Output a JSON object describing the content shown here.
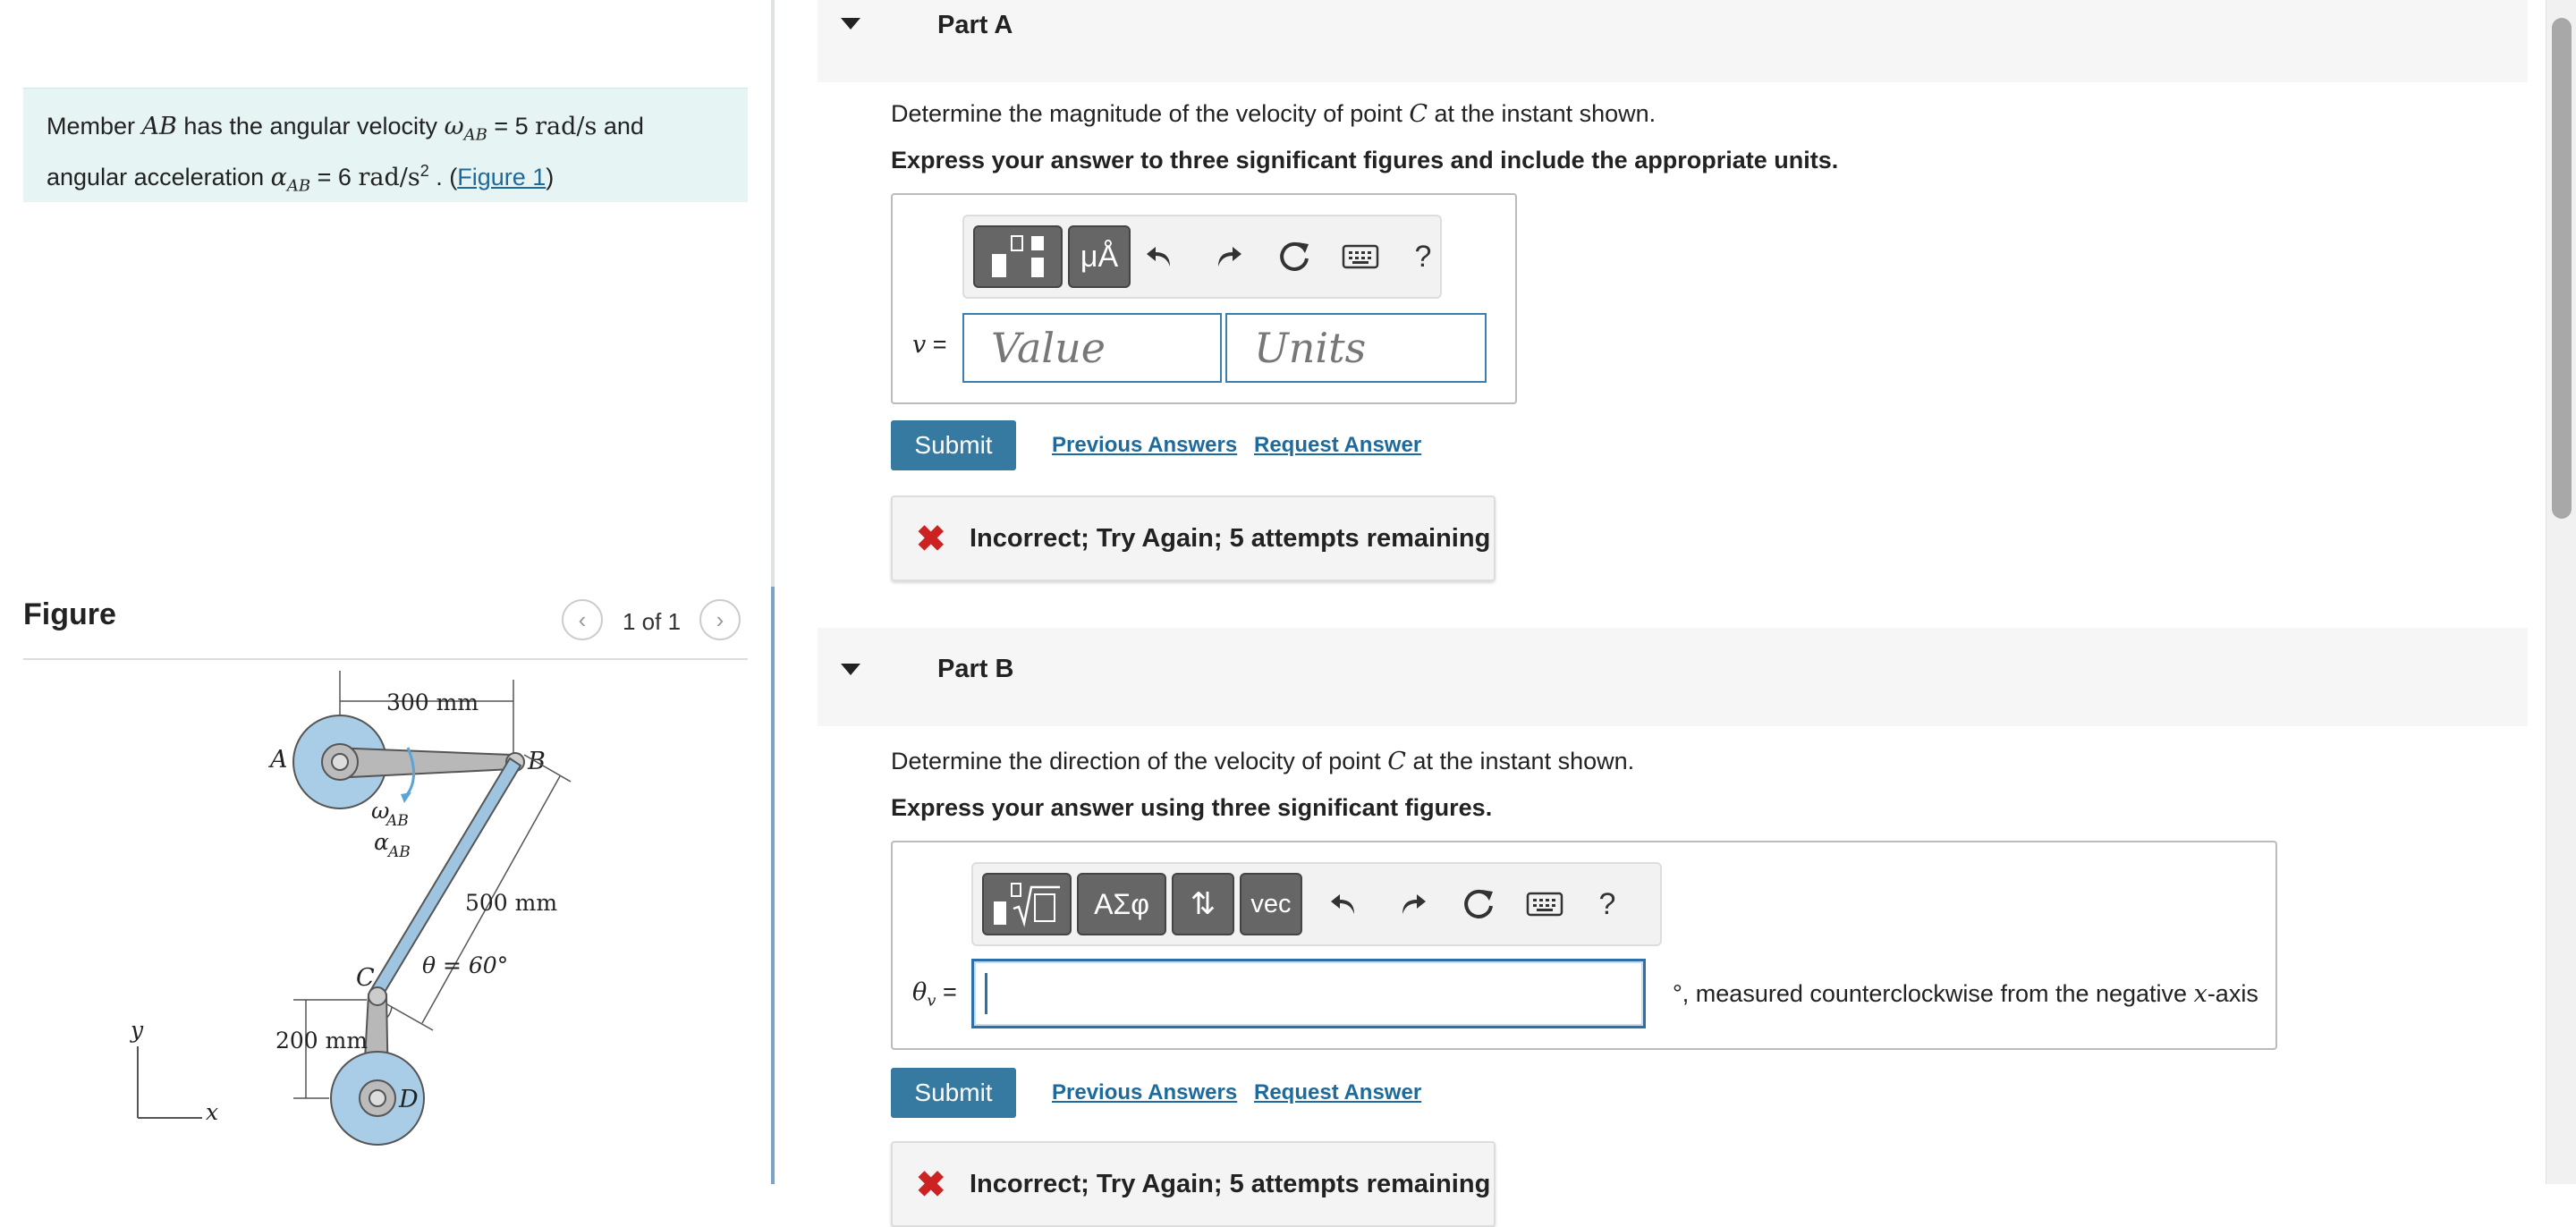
{
  "problem": {
    "prefix": "Member ",
    "member": "AB",
    "mid1": " has the angular velocity ",
    "omega_symbol": "ω",
    "omega_sub": "AB",
    "omega_value": " = 5 ",
    "omega_unit": "rad/s",
    "mid2": " and angular acceleration ",
    "alpha_symbol": "α",
    "alpha_sub": "AB",
    "alpha_value": " = 6 ",
    "alpha_unit": "rad/s",
    "alpha_unit_exp": "2",
    "mid3": " . (",
    "figure_link": "Figure 1",
    "suffix": ")"
  },
  "figure": {
    "title": "Figure",
    "pager": "1 of 1",
    "labels": {
      "A": "A",
      "B": "B",
      "C": "C",
      "D": "D",
      "len_ab": "300 mm",
      "len_bc": "500 mm",
      "len_cd": "200 mm",
      "theta": "θ = 60°",
      "omega": "ω",
      "omega_sub": "AB",
      "alpha": "α",
      "alpha_sub": "AB",
      "y_axis": "y",
      "x_axis": "x"
    }
  },
  "partA": {
    "title": "Part A",
    "question_pre": "Determine the magnitude of the velocity of point ",
    "question_var": "C",
    "question_post": " at the instant shown.",
    "instruction": "Express your answer to three significant figures and include the appropriate units.",
    "eq_var": "v",
    "eq_sign": " =",
    "value_placeholder": "Value",
    "units_placeholder": "Units",
    "unit_tool_label": "μÅ",
    "submit": "Submit",
    "previous_answers": "Previous Answers",
    "request_answer": "Request Answer",
    "feedback": "Incorrect; Try Again; 5 attempts remaining"
  },
  "partB": {
    "title": "Part B",
    "question_pre": "Determine the direction of the velocity of point ",
    "question_var": "C",
    "question_post": " at the instant shown.",
    "instruction": "Express your answer using three significant figures.",
    "eq_var": "θ",
    "eq_sub": "v",
    "eq_sign": " =",
    "suffix_pre": "°, measured counterclockwise from the negative ",
    "suffix_var": "x",
    "suffix_post": "-axis",
    "greek_label": "ΑΣφ",
    "vec_label": "vec",
    "submit": "Submit",
    "previous_answers": "Previous Answers",
    "request_answer": "Request Answer",
    "feedback": "Incorrect; Try Again; 5 attempts remaining"
  },
  "toolbar": {
    "help": "?"
  },
  "colors": {
    "accent": "#367aa1",
    "problem_bg": "#e6f4f3",
    "error": "#cc2222",
    "link": "#1f6a9a"
  }
}
